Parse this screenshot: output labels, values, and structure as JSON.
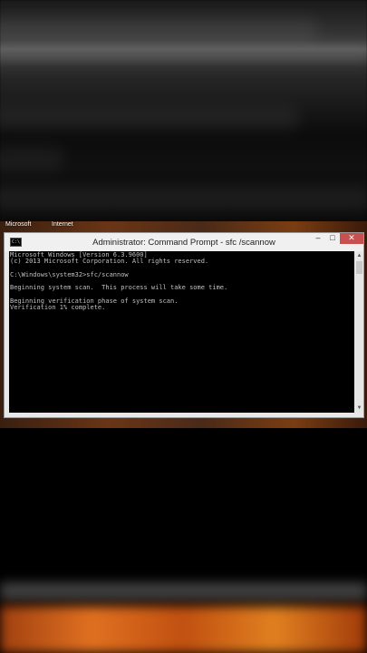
{
  "desktop": {
    "icons": [
      "Microsoft",
      "Internet"
    ]
  },
  "window": {
    "title": "Administrator: Command Prompt - sfc /scannow",
    "icon": "cmd-icon",
    "controls": {
      "minimize": "–",
      "maximize": "□",
      "close": "✕"
    }
  },
  "console": {
    "lines": [
      "Microsoft Windows [Version 6.3.9600]",
      "(c) 2013 Microsoft Corporation. All rights reserved.",
      "",
      "C:\\Windows\\system32>sfc/scannow",
      "",
      "Beginning system scan.  This process will take some time.",
      "",
      "Beginning verification phase of system scan.",
      "Verification 1% complete."
    ]
  },
  "colors": {
    "console_bg": "#000000",
    "console_text": "#c0c0c0",
    "close_button": "#c75050"
  }
}
